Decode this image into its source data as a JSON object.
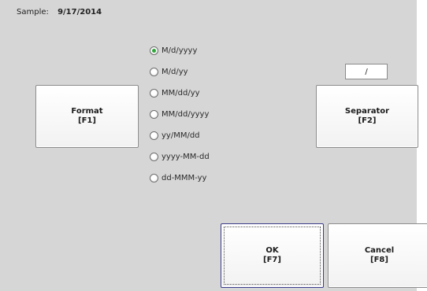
{
  "sample": {
    "label": "Sample:",
    "value": "9/17/2014"
  },
  "format_button": {
    "label": "Format",
    "key": "[F1]"
  },
  "separator_button": {
    "label": "Separator",
    "key": "[F2]"
  },
  "separator_field": {
    "value": "/"
  },
  "formats": [
    {
      "label": "M/d/yyyy",
      "selected": true
    },
    {
      "label": "M/d/yy",
      "selected": false
    },
    {
      "label": "MM/dd/yy",
      "selected": false
    },
    {
      "label": "MM/dd/yyyy",
      "selected": false
    },
    {
      "label": "yy/MM/dd",
      "selected": false
    },
    {
      "label": "yyyy-MM-dd",
      "selected": false
    },
    {
      "label": "dd-MMM-yy",
      "selected": false
    }
  ],
  "ok_button": {
    "label": "OK",
    "key": "[F7]"
  },
  "cancel_button": {
    "label": "Cancel",
    "key": "[F8]"
  },
  "colors": {
    "panel": "#d6d6d6",
    "radio_selected": "#2fa53a"
  }
}
